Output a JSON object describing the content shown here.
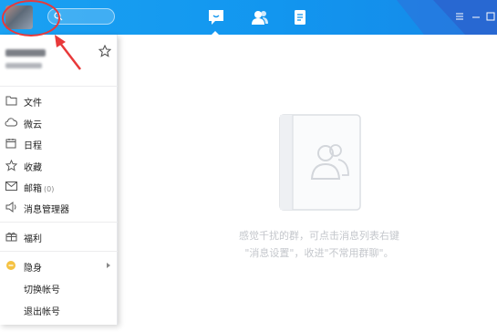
{
  "colors": {
    "titlebar": "#1296ef",
    "annotation": "#e8393a",
    "presence_dot": "#f5c242"
  },
  "titlebar": {
    "tabs": [
      {
        "name": "messages",
        "icon": "chat-bubble-icon",
        "active": true
      },
      {
        "name": "contacts",
        "icon": "contacts-icon",
        "active": false
      },
      {
        "name": "space",
        "icon": "document-icon",
        "active": false
      }
    ],
    "window_controls": [
      "menu-icon",
      "minimize-icon",
      "maximize-icon"
    ]
  },
  "menu": {
    "items": [
      {
        "label": "文件",
        "icon": "folder-icon"
      },
      {
        "label": "微云",
        "icon": "cloud-icon"
      },
      {
        "label": "日程",
        "icon": "calendar-icon"
      },
      {
        "label": "收藏",
        "icon": "star-icon"
      },
      {
        "label": "邮箱",
        "count": "(0)",
        "icon": "mail-icon"
      },
      {
        "label": "消息管理器",
        "icon": "speaker-icon"
      },
      {
        "label": "福利",
        "icon": "gift-icon"
      },
      {
        "label": "隐身",
        "icon": "presence-dot-icon",
        "has_submenu": true
      },
      {
        "label": "切换帐号"
      },
      {
        "label": "退出帐号"
      }
    ]
  },
  "empty_state": {
    "line1": "感觉千扰的群，可点击消息列表右键",
    "line2": "\"消息设置\"，收进\"不常用群聊\"。"
  }
}
